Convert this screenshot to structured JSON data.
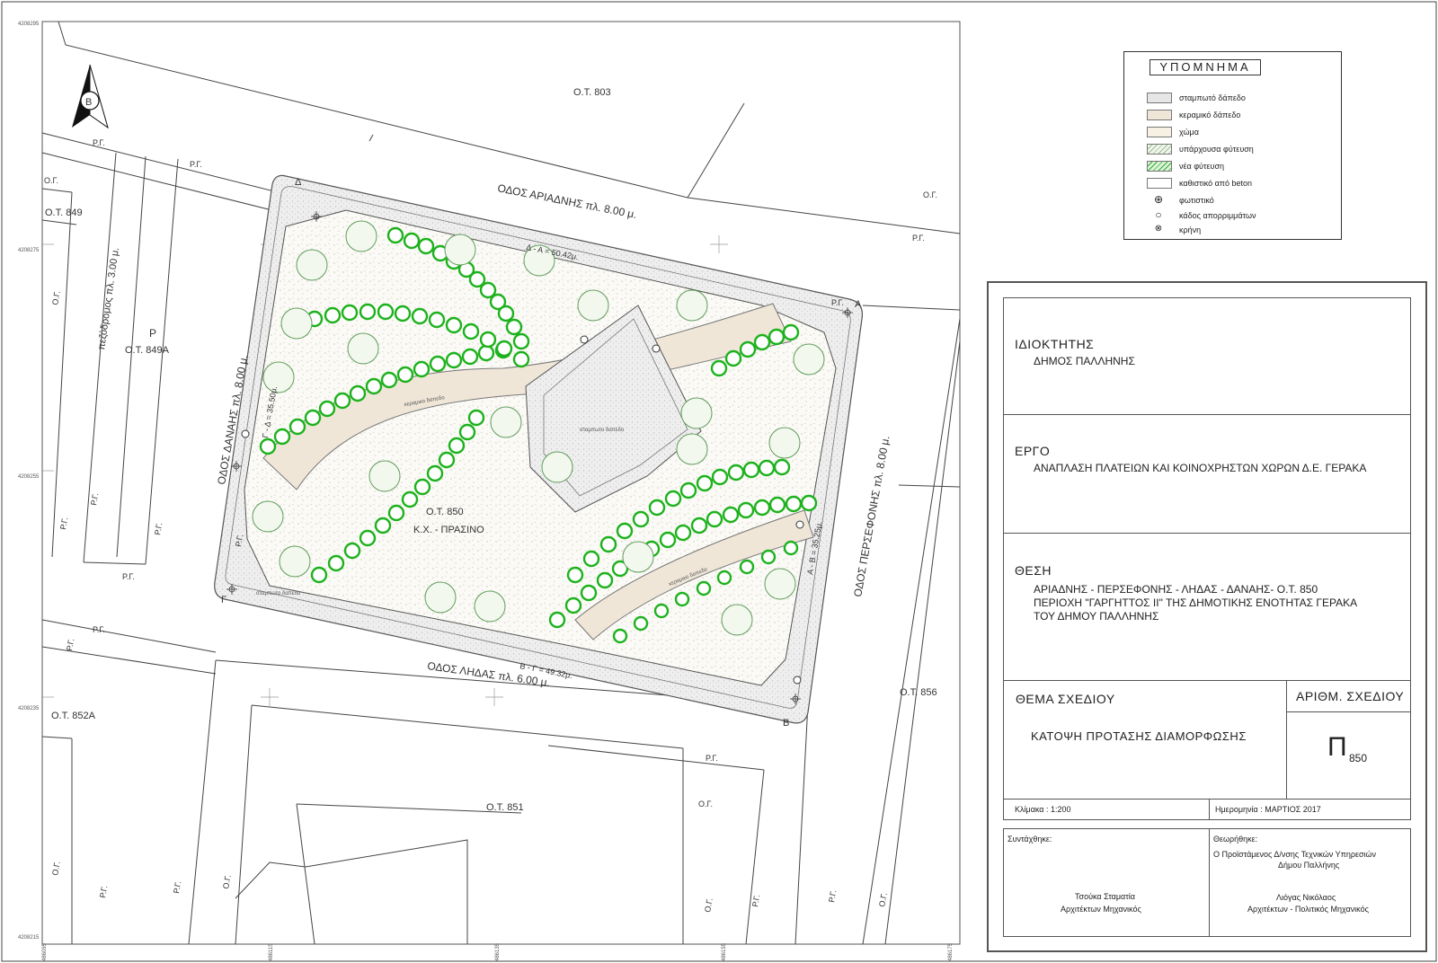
{
  "map": {
    "roads": {
      "ariadnis": "ΟΔΟΣ ΑΡΙΑΔΝΗΣ  πλ. 8.00 μ.",
      "danais": "ΟΔΟΣ ΔΑΝΑΗΣ  πλ. 8.00 μ.",
      "persefonis": "ΟΔΟΣ ΠΕΡΣΕΦΟΝΗΣ  πλ. 8.00 μ.",
      "lidas": "ΟΔΟΣ ΛΗΔΑΣ  πλ. 6.00 μ.",
      "pedestrian": "πεζόδρομος  πλ. 3.00 μ."
    },
    "blocks": {
      "ot803": "Ο.Τ. 803",
      "ot849": "Ο.Τ. 849",
      "ot849a": "Ο.Τ. 849Α",
      "ot852a": "Ο.Τ. 852Α",
      "ot851": "Ο.Τ. 851",
      "ot856": "Ο.Τ. 856",
      "ot850": "Ο.Τ. 850",
      "kx": "Κ.Χ. - ΠΡΑΣΙΝΟ",
      "parking": "Ρ"
    },
    "dims": {
      "da": "Δ - Α = 50.42μ.",
      "gd": "Γ - Δ = 35.50μ.",
      "ab": "Α - Β = 35.25μ.",
      "bg": "Β - Γ = 49.32μ."
    },
    "corners": {
      "a": "Α",
      "b": "Β",
      "g": "Γ",
      "d": "Δ"
    },
    "road_line": "Ρ.Γ.",
    "build_line": "Ο.Γ.",
    "surface": {
      "ceramic1": "κεραμικο δαπεδο",
      "ceramic2": "κεραμικο δαπεδο",
      "stamped": "σταμπωτο δαπεδο",
      "stamped2": "σταμπωτο δαπεδο"
    },
    "north_letter": "Β",
    "grid_y": [
      "4208295",
      "4208275",
      "4208255",
      "4208235",
      "4208215"
    ],
    "grid_x": [
      "486095",
      "486115",
      "486135",
      "486155",
      "486175"
    ]
  },
  "legend": {
    "title": "ΥΠΟΜΝΗΜΑ",
    "items": [
      {
        "label": "σταμπωτό δάπεδο",
        "color": "#e6e6e6"
      },
      {
        "label": "κεραμικό δάπεδο",
        "color": "#efe6d8"
      },
      {
        "label": "χώμα",
        "color": "#f7f1e4"
      },
      {
        "label": "υπάρχουσα φύτευση",
        "color": "#f2f6ee"
      },
      {
        "label": "νέα φύτευση",
        "color": "#a9dda0"
      },
      {
        "label": "καθιστικό από beton",
        "color": "#ffffff"
      },
      {
        "label": "φωτιστικό",
        "icon": "lamp-icon"
      },
      {
        "label": "κάδος απορριμμάτων",
        "icon": "bin-icon"
      },
      {
        "label": "κρήνη",
        "icon": "fountain-icon"
      }
    ]
  },
  "titleblock": {
    "owner_h": "ΙΔΙΟΚΤΗΤΗΣ",
    "owner_v": "ΔΗΜΟΣ ΠΑΛΛΗΝΗΣ",
    "project_h": "ΕΡΓΟ",
    "project_v": "ΑΝΑΠΛΑΣΗ ΠΛΑΤΕΙΩΝ ΚΑΙ ΚΟΙΝΟΧΡΗΣΤΩΝ ΧΩΡΩΝ Δ.Ε. ΓΕΡΑΚΑ",
    "place_h": "ΘΕΣΗ",
    "place_l1": "ΑΡΙΑΔΝΗΣ - ΠΕΡΣΕΦΟΝΗΣ - ΛΗΔΑΣ - ΔΑΝΑΗΣ- Ο.Τ. 850",
    "place_l2": "ΠΕΡΙΟΧΗ \"ΓΑΡΓΗΤΤΟΣ ΙΙ\" ΤΗΣ ΔΗΜΟΤΙΚΗΣ ΕΝΟΤΗΤΑΣ ΓΕΡΑΚΑ",
    "place_l3": "ΤΟΥ ΔΗΜΟΥ ΠΑΛΛΗΝΗΣ",
    "theme_h": "ΘΕΜΑ ΣΧΕΔΙΟΥ",
    "theme_v": "ΚΑΤΟΨΗ ΠΡΟΤΑΣΗΣ ΔΙΑΜΟΡΦΩΣΗΣ",
    "num_h": "ΑΡΙΘΜ. ΣΧΕΔΙΟΥ",
    "num_big": "Π",
    "num_small": "850",
    "scale": "Κλίμακα :  1:200",
    "date": "Ημερομηνία :  ΜΑΡΤΙΟΣ  2017",
    "compiled": "Συντάχθηκε:",
    "reviewed": "Θεωρήθηκε:",
    "author_name": "Τσούκα Σταματία",
    "author_title": "Αρχιτέκτων  Μηχανικός",
    "dir_l1": "Ο Προϊστάμενος Δ/νσης Τεχνικών Υπηρεσιών",
    "dir_l2": "Δήμου Παλλήνης",
    "dir_name": "Λιόγας Νικόλαος",
    "dir_title": "Αρχιτέκτων - Πολιτικός Μηχανικός"
  }
}
